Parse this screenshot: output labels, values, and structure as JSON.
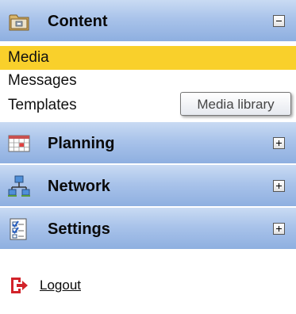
{
  "sections": [
    {
      "title": "Content",
      "icon": "folder-icon",
      "state": "expanded"
    },
    {
      "title": "Planning",
      "icon": "calendar-icon",
      "state": "collapsed"
    },
    {
      "title": "Network",
      "icon": "network-icon",
      "state": "collapsed"
    },
    {
      "title": "Settings",
      "icon": "checklist-icon",
      "state": "collapsed"
    }
  ],
  "content_items": [
    {
      "label": "Media",
      "selected": true
    },
    {
      "label": "Messages",
      "selected": false
    },
    {
      "label": "Templates",
      "selected": false
    }
  ],
  "tooltip": {
    "text": "Media library"
  },
  "logout": {
    "label": "Logout",
    "icon": "logout-icon"
  },
  "colors": {
    "header_gradient_top": "#c9dbf3",
    "header_gradient_bottom": "#8eafe0",
    "selected_item": "#f9d02b",
    "logout_icon": "#d2232a"
  }
}
